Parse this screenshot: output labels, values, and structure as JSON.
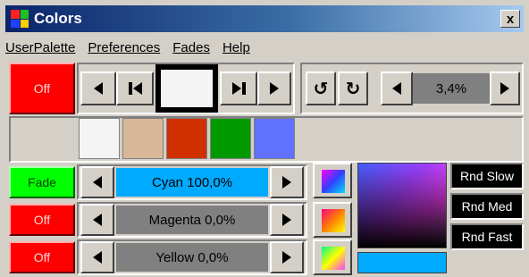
{
  "window": {
    "title": "Colors",
    "close_label": "x"
  },
  "menu": [
    "UserPalette",
    "Preferences",
    "Fades",
    "Help"
  ],
  "toggles": {
    "top_off": "Off",
    "fade": "Fade",
    "magenta_off": "Off",
    "yellow_off": "Off"
  },
  "zoom": {
    "value": "3,4%"
  },
  "channels": [
    {
      "label": "Cyan 100,0%",
      "color": "#00aaff"
    },
    {
      "label": "Magenta 0,0%",
      "color": "#808080"
    },
    {
      "label": "Yellow 0,0%",
      "color": "#808080"
    }
  ],
  "palette": [
    "#f4f4f4",
    "#d8b898",
    "#d03000",
    "#009a00",
    "#6070ff"
  ],
  "random_buttons": [
    "Rnd Slow",
    "Rnd Med",
    "Rnd Fast"
  ],
  "current_color": "#00aaff",
  "logo_colors": [
    "#ff2020",
    "#20c020",
    "#2040ff",
    "#ffcc00"
  ]
}
